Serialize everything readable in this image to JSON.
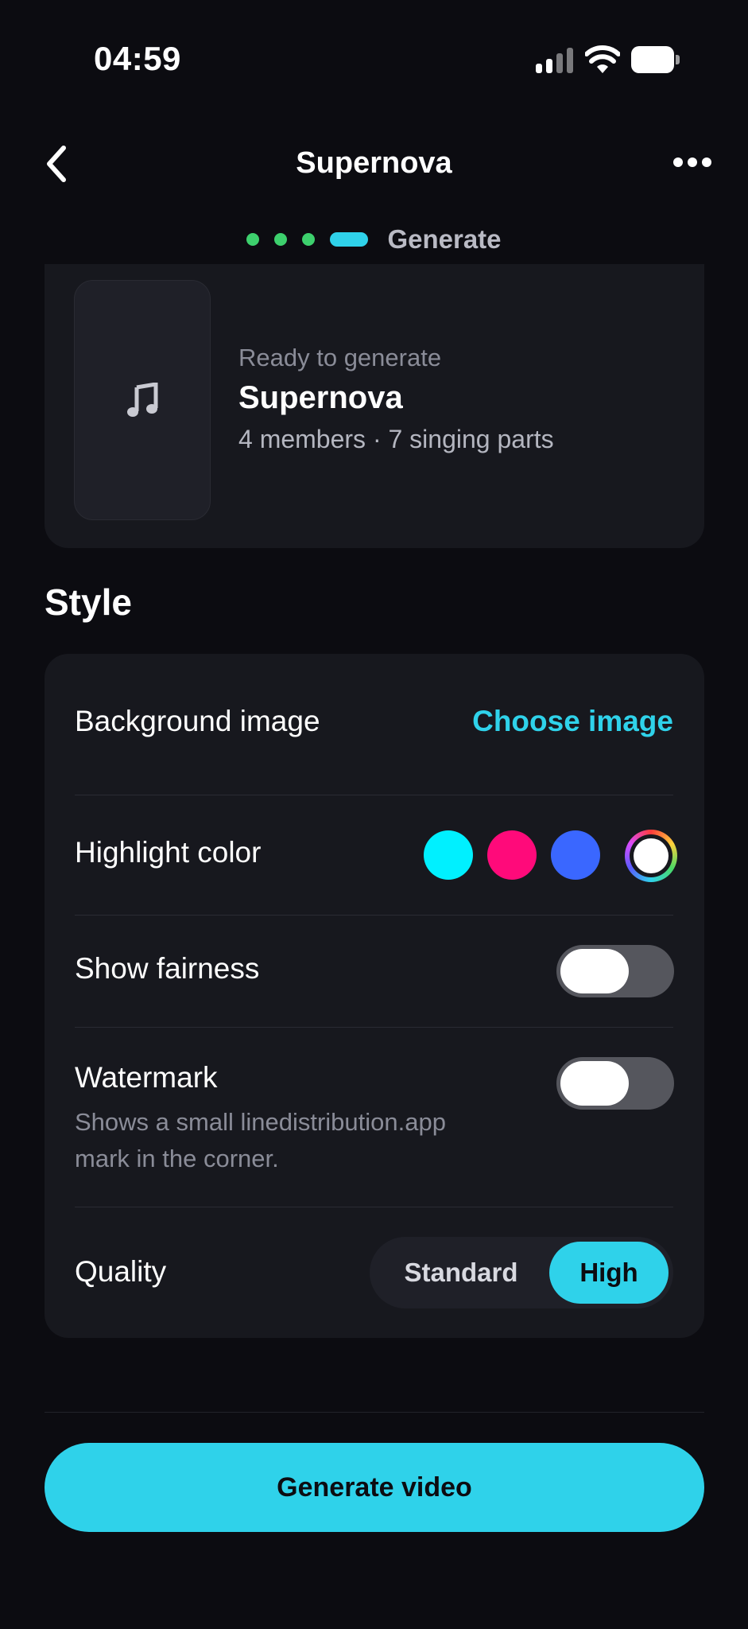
{
  "status_bar": {
    "time": "04:59"
  },
  "nav": {
    "title": "Supernova"
  },
  "steps": {
    "label": "Generate",
    "completed": 3,
    "current": 4
  },
  "song_card": {
    "status": "Ready to generate",
    "name": "Supernova",
    "meta": "4 members · 7 singing parts"
  },
  "style": {
    "heading": "Style",
    "background_image": {
      "label": "Background image",
      "action": "Choose image"
    },
    "highlight_color": {
      "label": "Highlight color",
      "swatches": [
        "#00f0ff",
        "#ff0a7a",
        "#3a67ff"
      ],
      "selected": "custom"
    },
    "show_fairness": {
      "label": "Show fairness",
      "on": false
    },
    "watermark": {
      "label": "Watermark",
      "description": "Shows a small linedistribution.app mark in the corner.",
      "on": false
    },
    "quality": {
      "label": "Quality",
      "options": [
        "Standard",
        "High"
      ],
      "selected": "High"
    }
  },
  "actions": {
    "generate_label": "Generate video"
  },
  "colors": {
    "accent": "#2fd2ea",
    "step_done": "#3dd06d",
    "background": "#0c0c11",
    "card": "#17181e"
  }
}
